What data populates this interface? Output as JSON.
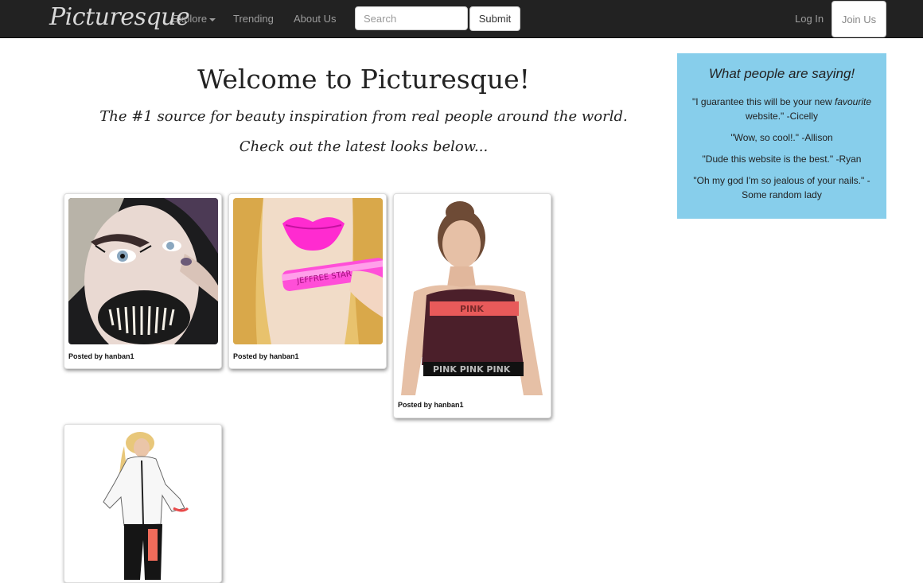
{
  "nav": {
    "brand": "Picturesque",
    "explore": "Explore",
    "trending": "Trending",
    "about": "About Us",
    "search_placeholder": "Search",
    "submit": "Submit",
    "login": "Log In",
    "join": "Join Us"
  },
  "hero": {
    "title": "Welcome to Picturesque!",
    "tagline": "The #1 source for beauty inspiration from real people around the world.",
    "cta": "Check out the latest looks below..."
  },
  "testimonials": {
    "heading": "What people are saying!",
    "q1_before": "\"I guarantee this will be your new ",
    "q1_em": "favourite",
    "q1_after": " website.\" -Cicelly",
    "q2": "\"Wow, so cool!.\" -Allison",
    "q3": "\"Dude this website is the best.\" -Ryan",
    "q4": "\"Oh my god I'm so jealous of your nails.\" - Some random lady"
  },
  "posts": [
    {
      "caption": "Posted by hanban1"
    },
    {
      "caption": "Posted by hanban1"
    },
    {
      "caption": "Posted by hanban1"
    },
    {
      "caption": ""
    }
  ],
  "colors": {
    "navbar": "#222222",
    "testimonial_bg": "#87ceeb",
    "lipstick": "#ff2bd0"
  }
}
